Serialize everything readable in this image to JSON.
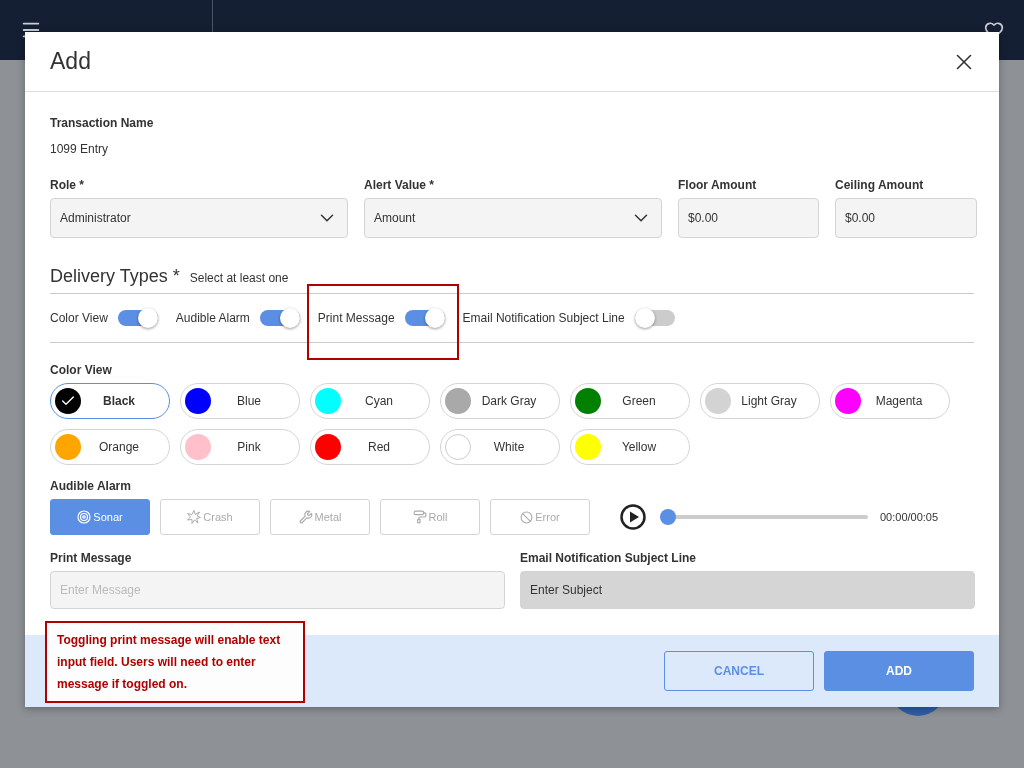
{
  "dialog": {
    "title": "Add",
    "transaction": {
      "label": "Transaction Name",
      "value": "1099 Entry"
    },
    "fields": [
      {
        "label": "Role *",
        "value": "Administrator",
        "kind": "select"
      },
      {
        "label": "Alert Value *",
        "value": "Amount",
        "kind": "select"
      },
      {
        "label": "Floor Amount",
        "value": "$0.00",
        "kind": "text"
      },
      {
        "label": "Ceiling Amount",
        "value": "$0.00",
        "kind": "text"
      }
    ],
    "delivery": {
      "title": "Delivery Types *",
      "hint": "Select at least one",
      "toggles": [
        {
          "label": "Color View",
          "on": true,
          "highlighted": false
        },
        {
          "label": "Audible Alarm",
          "on": true,
          "highlighted": false
        },
        {
          "label": "Print Message",
          "on": true,
          "highlighted": true
        },
        {
          "label": "Email Notification Subject Line",
          "on": false,
          "highlighted": false
        }
      ]
    },
    "color_view": {
      "label": "Color View",
      "colors": [
        {
          "name": "Black",
          "color": "#000000",
          "selected": true
        },
        {
          "name": "Blue",
          "color": "#0000ff",
          "selected": false
        },
        {
          "name": "Cyan",
          "color": "#00ffff",
          "selected": false
        },
        {
          "name": "Dark Gray",
          "color": "#a9a9a9",
          "selected": false
        },
        {
          "name": "Green",
          "color": "#008000",
          "selected": false
        },
        {
          "name": "Light Gray",
          "color": "#d3d3d3",
          "selected": false
        },
        {
          "name": "Magenta",
          "color": "#ff00ff",
          "selected": false
        },
        {
          "name": "Orange",
          "color": "#ffa500",
          "selected": false
        },
        {
          "name": "Pink",
          "color": "#ffc0cb",
          "selected": false
        },
        {
          "name": "Red",
          "color": "#ff0000",
          "selected": false
        },
        {
          "name": "White",
          "color": "#ffffff",
          "selected": false
        },
        {
          "name": "Yellow",
          "color": "#ffff00",
          "selected": false
        }
      ]
    },
    "audible_alarm": {
      "label": "Audible Alarm",
      "sounds": [
        {
          "label": "Sonar",
          "kind": "sonar",
          "selected": true
        },
        {
          "label": "Crash",
          "kind": "crash",
          "selected": false
        },
        {
          "label": "Metal",
          "kind": "metal",
          "selected": false
        },
        {
          "label": "Roll",
          "kind": "roll",
          "selected": false
        },
        {
          "label": "Error",
          "kind": "error",
          "selected": false
        }
      ],
      "player": {
        "time": "00:00/00:05",
        "level": 0
      }
    },
    "message_fields": [
      {
        "label": "Print Message",
        "placeholder": "Enter Message",
        "disabled": false
      },
      {
        "label": "Email Notification Subject Line",
        "placeholder": "Enter Subject",
        "disabled": true
      }
    ],
    "buttons": [
      {
        "label": "CANCEL",
        "kind": "secondary"
      },
      {
        "label": "ADD",
        "kind": "primary"
      }
    ]
  },
  "note": {
    "text": "Toggling print message will enable text input field. Users will need to enter message if toggled on."
  }
}
